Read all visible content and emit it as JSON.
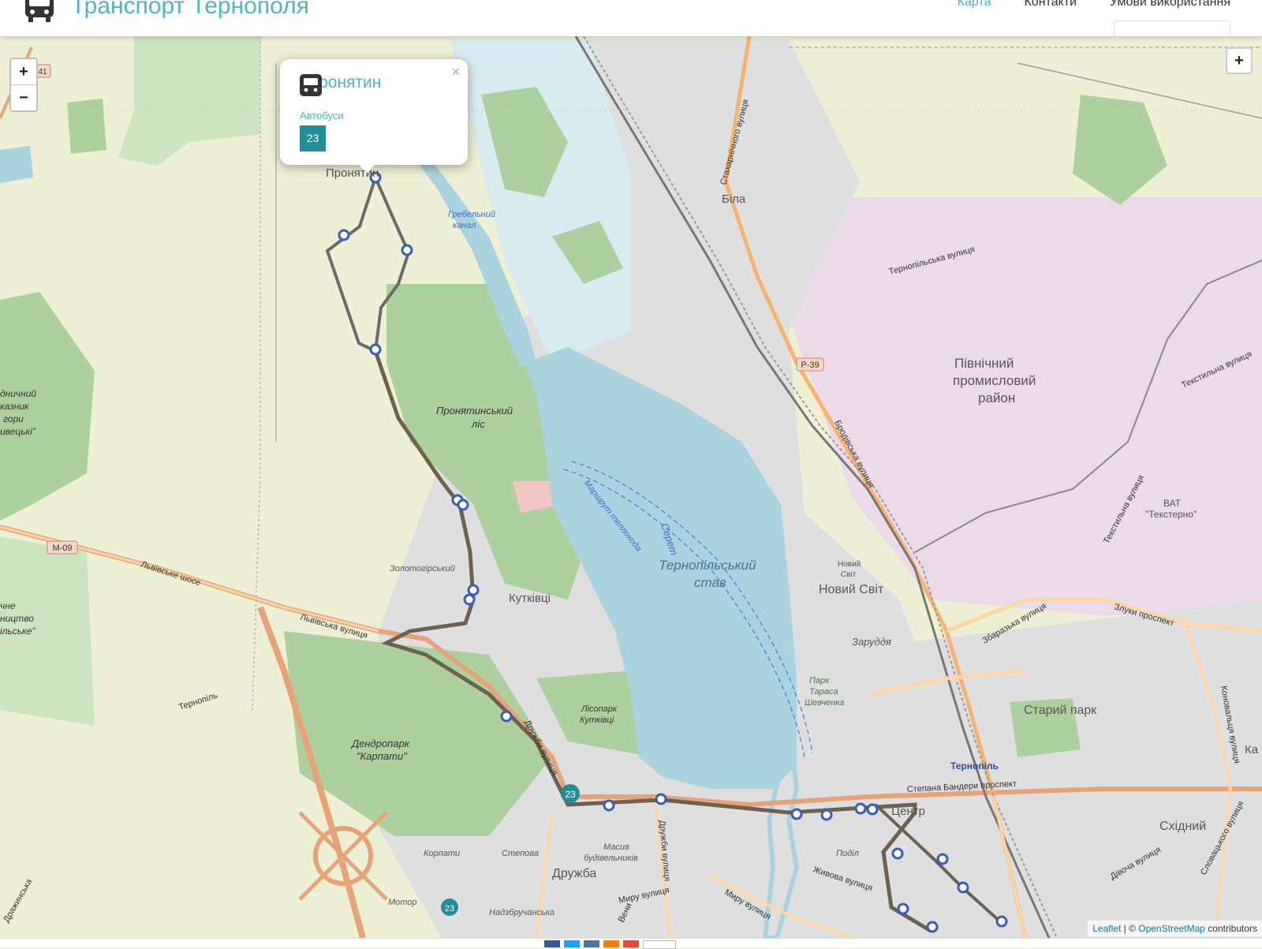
{
  "header": {
    "title": "Транспорт Тернополя",
    "logo_icon": "bus-icon",
    "nav": [
      {
        "label": "Карта",
        "active": true
      },
      {
        "label": "Контакти",
        "active": false
      },
      {
        "label": "Умови використання",
        "active": false
      }
    ]
  },
  "map": {
    "zoom_in": "+",
    "zoom_out": "−",
    "expand": "+",
    "route_badge": "23",
    "route_badge_2": "23",
    "labels": {
      "pronyatyn": "Пронятин",
      "bila": "Біла",
      "ternopilska_vul": "Тернопільська вулиця",
      "p39": "Р-39",
      "pivnichnyi": "Північний",
      "promyslovyi": "промисловий",
      "raion": "район",
      "tekstylna": "Текстильна вулиця",
      "tekstylna_2": "Текстильна вулиця",
      "vat1": "ВАТ",
      "vat2": "\"Текстерно\"",
      "hrebelnyi1": "Гребельний",
      "hrebelnyi2": "канал",
      "pronyatynskyi1": "Пронятинський",
      "pronyatynskyi2": "ліс",
      "marshrut": "Маршрут теплохода",
      "seret": "Серет",
      "stav1": "Тернопільський",
      "stav2": "став",
      "novyi_svit": "Новий Світ",
      "novyi_svit_small1": "Новий",
      "novyi_svit_small2": "Світ",
      "zarudda": "Заруддя",
      "park1": "Парк",
      "park2": "Тараса",
      "park3": "Шевченка",
      "zolotogirskyi": "Золотогірський",
      "kutkivtsi": "Кутківці",
      "lvivske_shose": "Львівське шосе",
      "lvivska_vul": "Львівська вулиця",
      "m09": "М-09",
      "t41": "41",
      "ternopil_road": "Тернопіль",
      "dendropark1": "Дендропарк",
      "dendropark2": "\"Карпати\"",
      "lisopark1": "Лісопарк",
      "lisopark2": "Кутківці",
      "druzhba": "Дружба",
      "korpaty": "Корпати",
      "stepova": "Степова",
      "masiv1": "Масив",
      "masiv2": "будівельників",
      "motor": "Мотор",
      "nadzbruchanska": "Надзбручанська",
      "myru": "Миру вулиця",
      "myru_2": "Миру вулиця",
      "druzhby": "Дружби вулиця",
      "zhyvova": "Живова вулиця",
      "podil": "Поділ",
      "tsentr": "Центр",
      "ternopil": "Тернопіль",
      "staryi_park": "Старий парк",
      "skhidnyi": "Східний",
      "bandery": "Степана Бандери проспект",
      "zbarazka": "Збаразька вулиця",
      "zluky": "Злуки проспект",
      "brodivska": "Бродівська вулиця",
      "valova": "Дівоча вулиця",
      "slovatskoho": "Словацького вулиця",
      "konovaltsia": "Коновальця вулиця",
      "drazhynska": "Дражинська",
      "left1": "дничний",
      "left2": "казник",
      "left3": "гори",
      "left4": "ивецькі\"",
      "left5": "чне",
      "left6": "ництво",
      "left7": "ільське\"",
      "saharnoho": "Стахарнічного вулиця",
      "ka": "Ка",
      "vesna": "Вени"
    }
  },
  "popup": {
    "title": "Пронятин",
    "icon": "bus-icon",
    "subtitle": "Автобуси",
    "route": "23",
    "close": "×"
  },
  "attribution": {
    "leaflet": "Leaflet",
    "separator": " | © ",
    "osm": "OpenStreetMap",
    "suffix": " contributors"
  },
  "colors": {
    "accent": "#4fb3c0",
    "route_badge": "#218d97",
    "route_line": "#666666",
    "route_line_lower": "#6d6250",
    "water": "#aad3df",
    "forest": "#add19e",
    "industrial": "#ebdbe8",
    "farmland": "#eef0d5"
  }
}
